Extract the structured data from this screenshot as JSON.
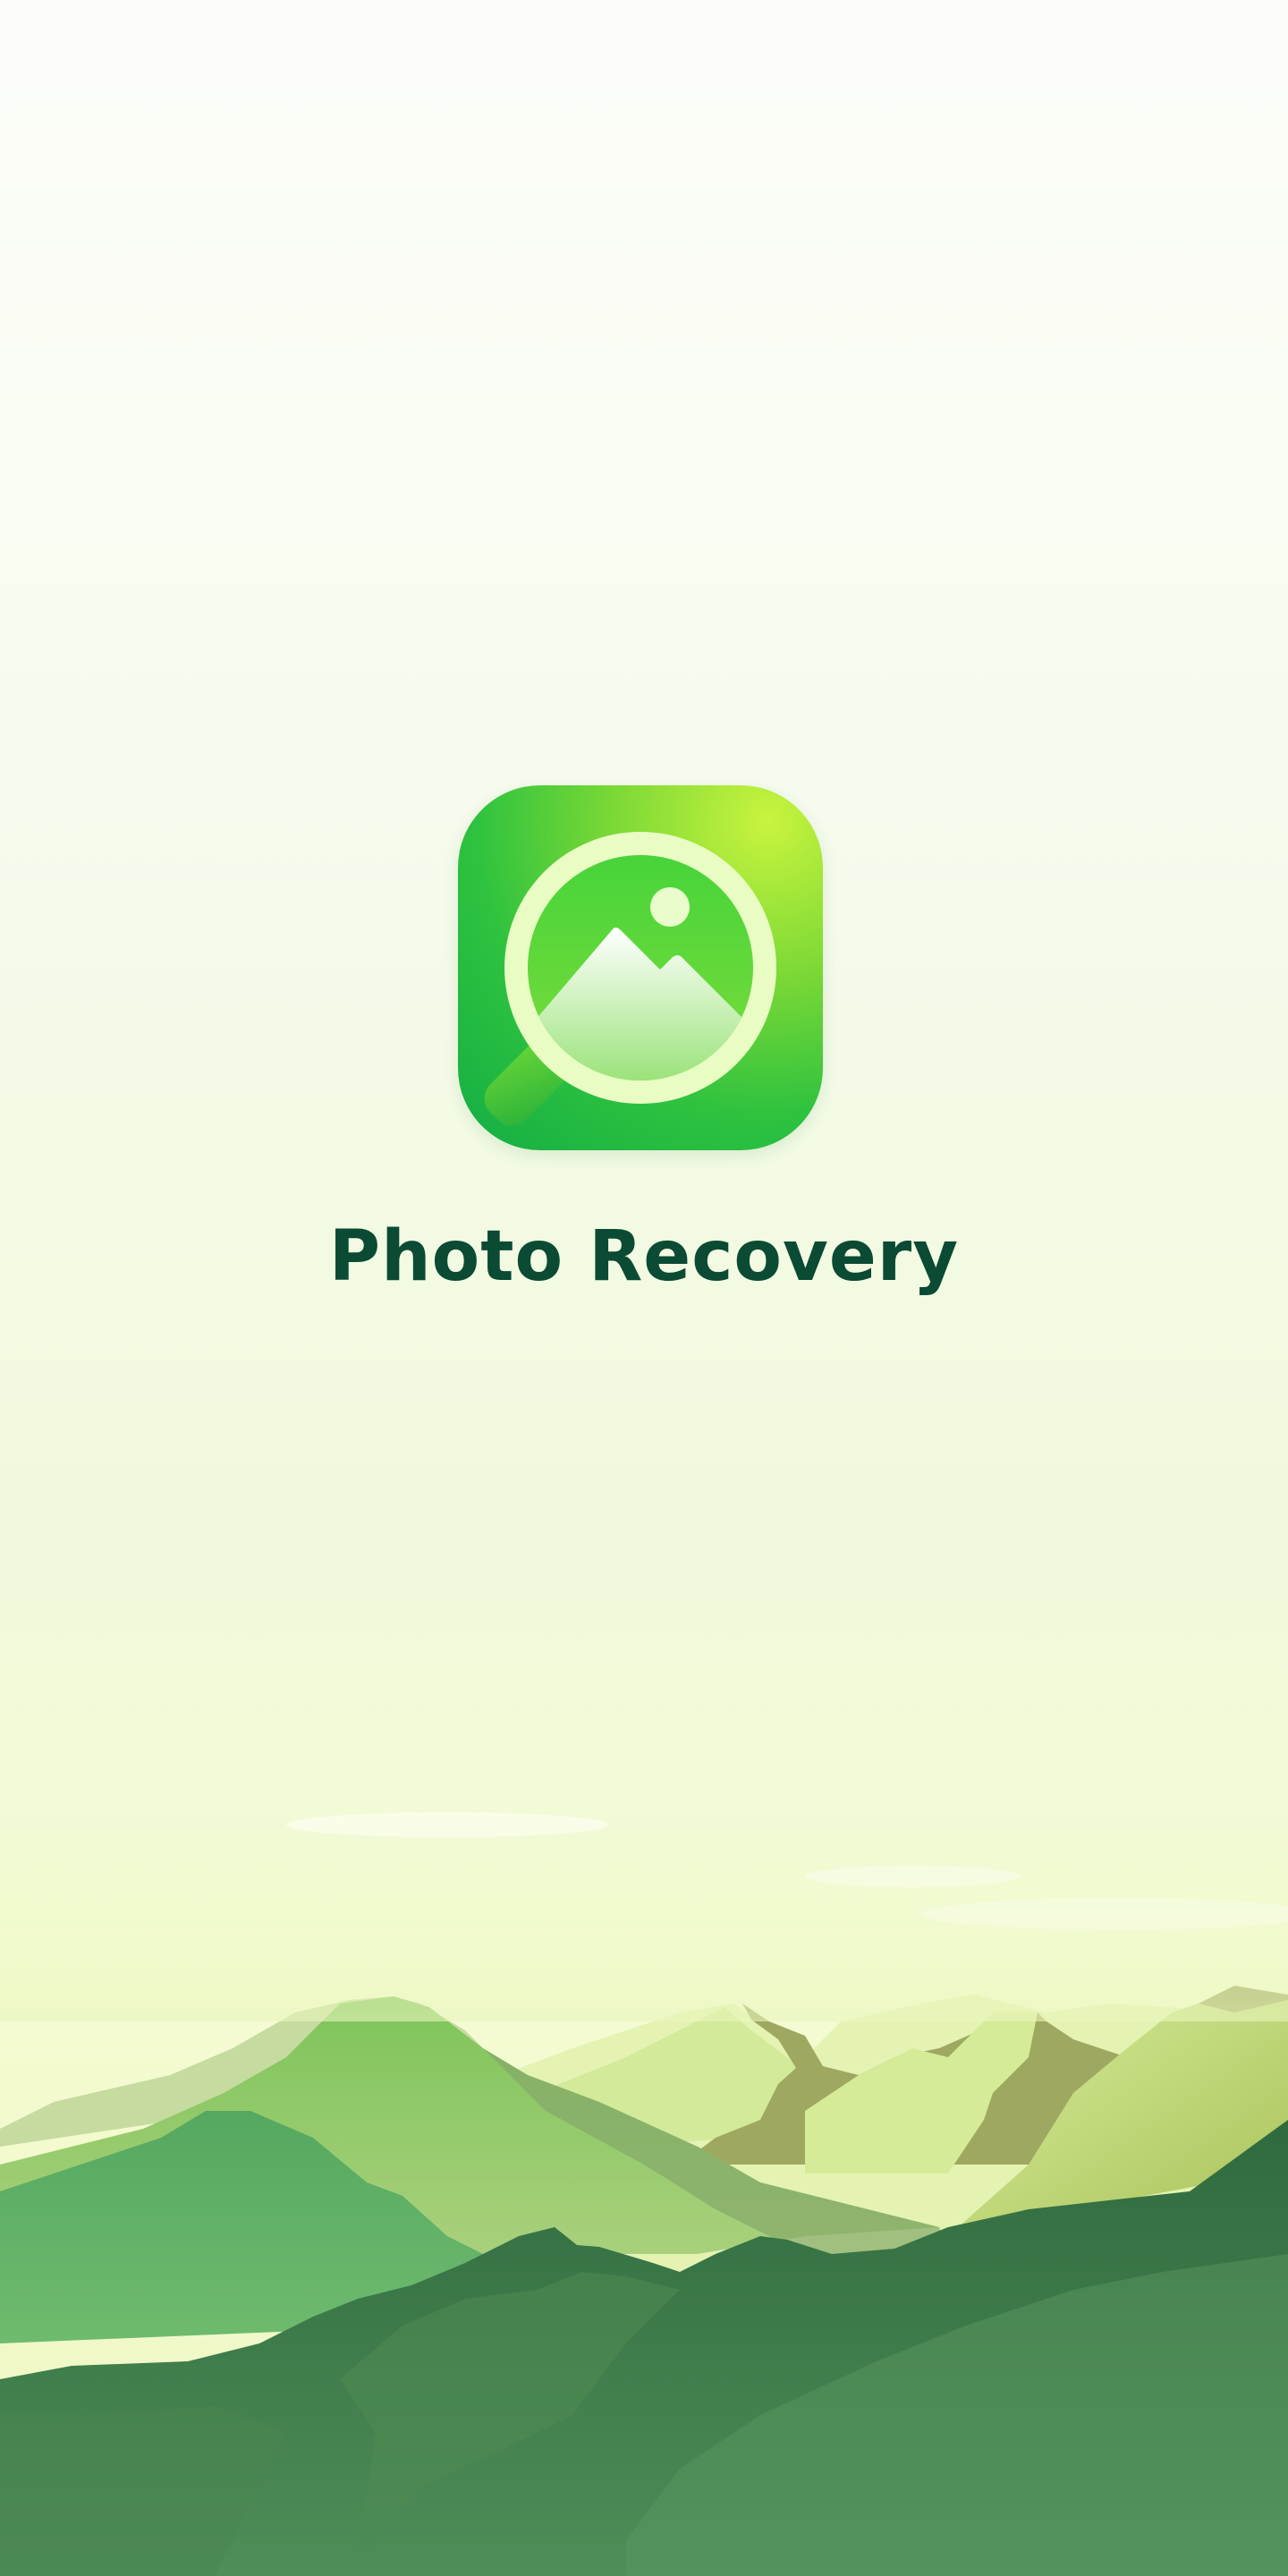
{
  "app": {
    "title": "Photo Recovery",
    "icon": "photo-magnifier-icon"
  },
  "colors": {
    "title": "#0b4a33",
    "icon_green_dark": "#13ad45",
    "icon_green_light": "#c9f43e",
    "mountain_dark": "#2f6a3e"
  }
}
